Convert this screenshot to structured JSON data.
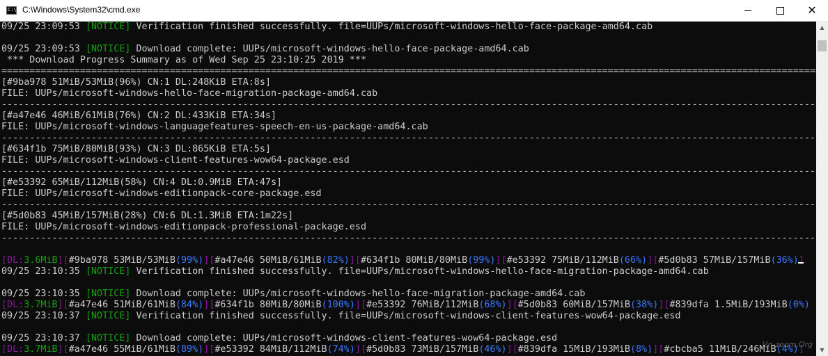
{
  "window": {
    "title": "C:\\Windows\\System32\\cmd.exe",
    "icon_text": "C:\\",
    "controls": {
      "minimize": "minimize-icon",
      "maximize": "maximize-icon",
      "close": "close-icon"
    }
  },
  "colors": {
    "background": "#0c0c0c",
    "text": "#cccccc",
    "green": "#13a10e",
    "purple": "#881798",
    "blue": "#3b78ff"
  },
  "lines": {
    "l01": {
      "ts": "09/25 23:09:53 ",
      "tag_l": "[",
      "tag": "NOTICE",
      "tag_r": "]",
      "msg": " Verification finished successfully. file=UUPs/microsoft-windows-hello-face-package-amd64.cab"
    },
    "l03": {
      "ts": "09/25 23:09:53 ",
      "tag_l": "[",
      "tag": "NOTICE",
      "tag_r": "]",
      "msg": " Download complete: UUPs/microsoft-windows-hello-face-package-amd64.cab"
    },
    "l04": " *** Download Progress Summary as of Wed Sep 25 23:10:25 2019 ***",
    "l05": "=================================================================================================================================================================",
    "l06": "[#9ba978 51MiB/53MiB(96%) CN:1 DL:248KiB ETA:8s]",
    "l07": "FILE: UUPs/microsoft-windows-hello-face-migration-package-amd64.cab",
    "l08": "-----------------------------------------------------------------------------------------------------------------------------------------------------------------",
    "l09": "[#a47e46 46MiB/61MiB(76%) CN:2 DL:433KiB ETA:34s]",
    "l10": "FILE: UUPs/microsoft-windows-languagefeatures-speech-en-us-package-amd64.cab",
    "l11": "-----------------------------------------------------------------------------------------------------------------------------------------------------------------",
    "l12": "[#634f1b 75MiB/80MiB(93%) CN:3 DL:865KiB ETA:5s]",
    "l13": "FILE: UUPs/microsoft-windows-client-features-wow64-package.esd",
    "l14": "-----------------------------------------------------------------------------------------------------------------------------------------------------------------",
    "l15": "[#e53392 65MiB/112MiB(58%) CN:4 DL:0.9MiB ETA:47s]",
    "l16": "FILE: UUPs/microsoft-windows-editionpack-core-package.esd",
    "l17": "-----------------------------------------------------------------------------------------------------------------------------------------------------------------",
    "l18": "[#5d0b83 45MiB/157MiB(28%) CN:6 DL:1.3MiB ETA:1m22s]",
    "l19": "FILE: UUPs/microsoft-windows-editionpack-professional-package.esd",
    "l20": "-----------------------------------------------------------------------------------------------------------------------------------------------------------------",
    "l22": {
      "dl_l": "[",
      "dl_k": "DL:",
      "dl_v": "3.6MiB",
      "dl_r": "]",
      "i1_l": "[",
      "i1_t": "#9ba978 53MiB/53MiB",
      "i1_p": "(99%)",
      "i1_r": "]",
      "i2_l": "[",
      "i2_t": "#a47e46 50MiB/61MiB",
      "i2_p": "(82%)",
      "i2_r": "]",
      "i3_l": "[",
      "i3_t": "#634f1b 80MiB/80MiB",
      "i3_p": "(99%)",
      "i3_r": "]",
      "i4_l": "[",
      "i4_t": "#e53392 75MiB/112MiB",
      "i4_p": "(66%)",
      "i4_r": "]",
      "i5_l": "[",
      "i5_t": "#5d0b83 57MiB/157MiB",
      "i5_p": "(36%)",
      "i5_r": "]"
    },
    "l23": {
      "ts": "09/25 23:10:35 ",
      "tag_l": "[",
      "tag": "NOTICE",
      "tag_r": "]",
      "msg": " Verification finished successfully. file=UUPs/microsoft-windows-hello-face-migration-package-amd64.cab"
    },
    "l25": {
      "ts": "09/25 23:10:35 ",
      "tag_l": "[",
      "tag": "NOTICE",
      "tag_r": "]",
      "msg": " Download complete: UUPs/microsoft-windows-hello-face-migration-package-amd64.cab"
    },
    "l26": {
      "dl_l": "[",
      "dl_k": "DL:",
      "dl_v": "3.7MiB",
      "dl_r": "]",
      "i1_l": "[",
      "i1_t": "#a47e46 51MiB/61MiB",
      "i1_p": "(84%)",
      "i1_r": "]",
      "i2_l": "[",
      "i2_t": "#634f1b 80MiB/80MiB",
      "i2_p": "(100%)",
      "i2_r": "]",
      "i3_l": "[",
      "i3_t": "#e53392 76MiB/112MiB",
      "i3_p": "(68%)",
      "i3_r": "]",
      "i4_l": "[",
      "i4_t": "#5d0b83 60MiB/157MiB",
      "i4_p": "(38%)",
      "i4_r": "]",
      "i5_l": "[",
      "i5_t": "#839dfa 1.5MiB/193MiB",
      "i5_p": "(0%)",
      "i5_r": ""
    },
    "l27": {
      "ts": "09/25 23:10:37 ",
      "tag_l": "[",
      "tag": "NOTICE",
      "tag_r": "]",
      "msg": " Verification finished successfully. file=UUPs/microsoft-windows-client-features-wow64-package.esd"
    },
    "l29": {
      "ts": "09/25 23:10:37 ",
      "tag_l": "[",
      "tag": "NOTICE",
      "tag_r": "]",
      "msg": " Download complete: UUPs/microsoft-windows-client-features-wow64-package.esd"
    },
    "l30": {
      "dl_l": "[",
      "dl_k": "DL:",
      "dl_v": "3.7MiB",
      "dl_r": "]",
      "i1_l": "[",
      "i1_t": "#a47e46 55MiB/61MiB",
      "i1_p": "(89%)",
      "i1_r": "]",
      "i2_l": "[",
      "i2_t": "#e53392 84MiB/112MiB",
      "i2_p": "(74%)",
      "i2_r": "]",
      "i3_l": "[",
      "i3_t": "#5d0b83 73MiB/157MiB",
      "i3_p": "(46%)",
      "i3_r": "]",
      "i4_l": "[",
      "i4_t": "#839dfa 15MiB/193MiB",
      "i4_p": "(8%)",
      "i4_r": "]",
      "i5_l": "[",
      "i5_t": "#cbcba5 11MiB/246MiB",
      "i5_p": "(4%)",
      "i5_r": "]"
    }
  },
  "watermark": "Vn-zoom.Org"
}
